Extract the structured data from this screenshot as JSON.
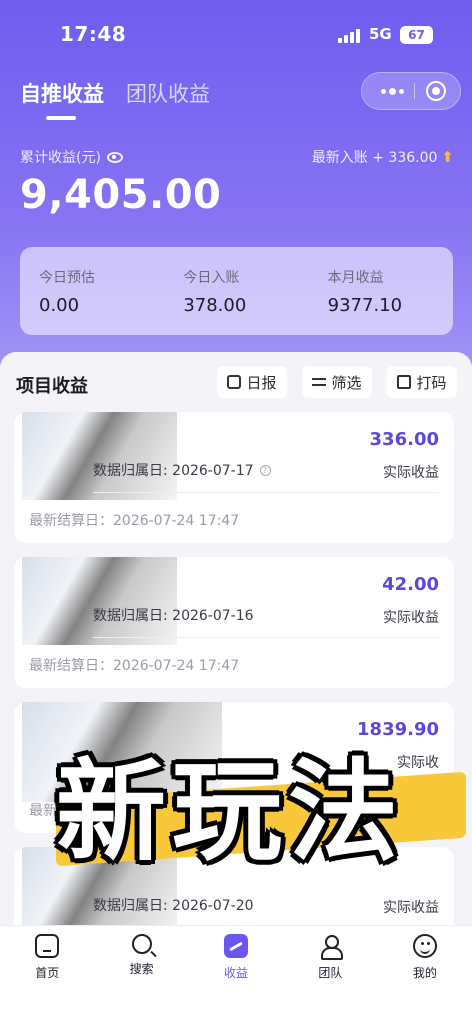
{
  "status": {
    "time": "17:48",
    "network": "5G",
    "battery": "67"
  },
  "tabs": [
    {
      "label": "自推收益"
    },
    {
      "label": "团队收益"
    }
  ],
  "summary": {
    "total_label": "累计收益(元)",
    "latest_label": "最新入账 + 336.00",
    "total_amount": "9,405.00"
  },
  "stats": [
    {
      "label": "今日预估",
      "value": "0.00"
    },
    {
      "label": "今日入账",
      "value": "378.00"
    },
    {
      "label": "本月收益",
      "value": "9377.10"
    }
  ],
  "section": {
    "title": "项目收益",
    "buttons": {
      "daily": "日报",
      "filter": "筛选",
      "print": "打码"
    }
  },
  "cards": [
    {
      "amount": "336.00",
      "amount_label": "实际收益",
      "date": "数据归属日: 2026-07-17",
      "settle": "最新结算日：2026-07-24 17:47"
    },
    {
      "amount": "42.00",
      "amount_label": "实际收益",
      "date": "数据归属日: 2026-07-16",
      "settle": "最新结算日：2026-07-24 17:47"
    },
    {
      "amount": "1839.90",
      "amount_label": "实际收",
      "date": "",
      "settle": "最新"
    },
    {
      "amount": "",
      "amount_label": "实际收益",
      "date": "数据归属日: 2026-07-20",
      "settle": ""
    }
  ],
  "overlay": {
    "text": "新玩法"
  },
  "nav": [
    {
      "label": "首页",
      "icon": "home-icon"
    },
    {
      "label": "搜索",
      "icon": "search-icon"
    },
    {
      "label": "收益",
      "icon": "income-icon"
    },
    {
      "label": "团队",
      "icon": "team-icon"
    },
    {
      "label": "我的",
      "icon": "profile-icon"
    }
  ],
  "colors": {
    "accent": "#6b57ee",
    "hero_top": "#6f5cf0",
    "highlight": "#f8c83a",
    "arrow": "#ffb25a"
  }
}
